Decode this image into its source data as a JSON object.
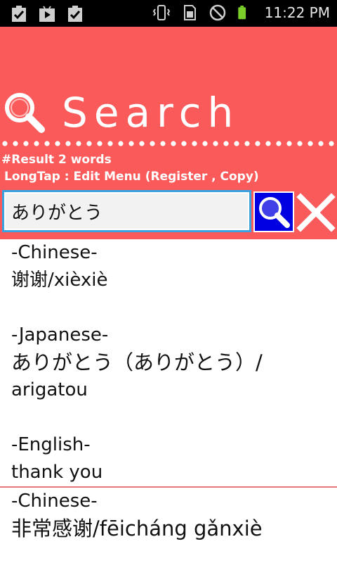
{
  "status_bar": {
    "time": "11:22 PM",
    "icons": [
      "clipboard-check-icon",
      "play-store-icon",
      "clipboard-check-icon",
      "vibrate-icon",
      "sim-card-icon",
      "no-signal-icon",
      "battery-icon"
    ]
  },
  "header": {
    "title": "Search",
    "result_count": "#Result 2 words",
    "hint": "LongTap : Edit Menu (Register , Copy)",
    "background": "#fa5a5a"
  },
  "search": {
    "query": "ありがとう"
  },
  "results": [
    {
      "chinese_label": "-Chinese-",
      "chinese_value": "谢谢/xièxiè",
      "japanese_label": "-Japanese-",
      "japanese_value": "ありがとう（ありがとう）/",
      "japanese_romaji": "arigatou",
      "english_label": "-English-",
      "english_value": "thank you"
    },
    {
      "chinese_label": "-Chinese-",
      "chinese_value": "非常感谢/fēicháng gǎnxiè"
    }
  ]
}
